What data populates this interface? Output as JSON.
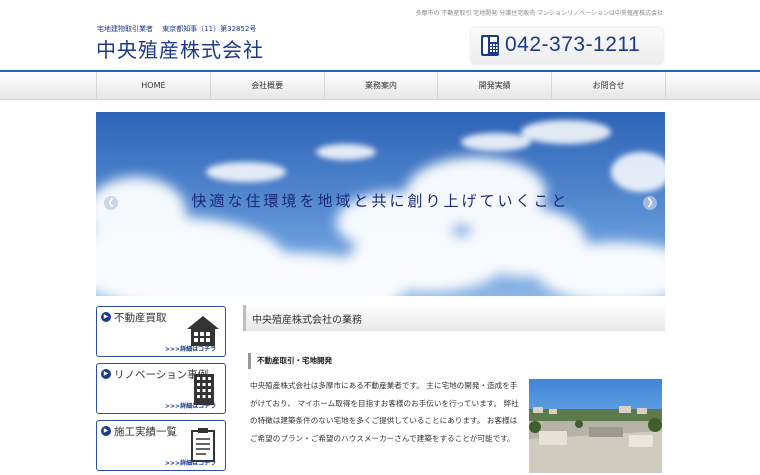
{
  "header": {
    "tagline": "多摩市の 不動産取引 宅地開発 分譲住宅販売 マンションリノベーションは中央殖産株式会社",
    "license": "宅地建物取引業者　 東京都知事（11）第32852号",
    "company_name": "中央殖産株式会社",
    "phone": "042-373-1211",
    "phone_icon": "phone-icon"
  },
  "nav": {
    "items": [
      {
        "label": "HOME"
      },
      {
        "label": "会社概要"
      },
      {
        "label": "業務案内"
      },
      {
        "label": "開発実績"
      },
      {
        "label": "お問合せ"
      }
    ]
  },
  "hero": {
    "caption": "快適な住環境を地域と共に創り上げていくこと",
    "prev_icon": "chevron-left-icon",
    "next_icon": "chevron-right-icon"
  },
  "sidebar": {
    "cards": [
      {
        "title": "不動産買取",
        "more": ">>>詳細はコチラ",
        "icon": "house-icon"
      },
      {
        "title": "リノベーション事例",
        "more": ">>>詳細はコチラ",
        "icon": "building-icon"
      },
      {
        "title": "施工実績一覧",
        "more": ">>>詳細はコチラ",
        "icon": "document-icon"
      }
    ]
  },
  "main": {
    "section_title": "中央殖産株式会社の業務",
    "sub_title": "不動産取引・宅地開発",
    "body": "中央殖産株式会社は多摩市にある不動産業者です。 主に宅地の開発・造成を手がけており、 マイホーム取得を目指すお客様のお手伝いを行っています。 弊社の特徴は建築条件のない宅地を多くご提供していることにあります。 お客様はご希望のプラン・ご希望のハウスメーカーさんで建築をすることが可能です。"
  },
  "colors": {
    "brand": "#1c3a8c",
    "accent_line": "#2b5fbf",
    "sky": "#3a6fc0"
  }
}
